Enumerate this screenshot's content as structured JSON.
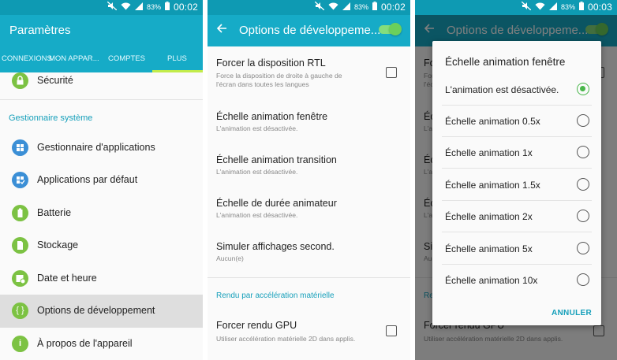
{
  "status_bar": [
    {
      "battery": "83%",
      "time": "00:02"
    },
    {
      "battery": "83%",
      "time": "00:02"
    },
    {
      "battery": "83%",
      "time": "00:03"
    }
  ],
  "settings": {
    "title": "Paramètres",
    "tabs": [
      "CONNEXIONS",
      "MON APPAR...",
      "COMPTES",
      "PLUS"
    ],
    "active_tab": "PLUS",
    "top_item": "Sécurité",
    "section": "Gestionnaire système",
    "items": [
      "Gestionnaire d'applications",
      "Applications par défaut",
      "Batterie",
      "Stockage",
      "Date et heure",
      "Options de développement",
      "À propos de l'appareil"
    ],
    "selected_item": "Options de développement"
  },
  "dev_options": {
    "title": "Options de développeme...",
    "toggle_on": true,
    "rtl": {
      "title": "Forcer la disposition RTL",
      "sub1": "Force la disposition de droite à gauche de",
      "sub2": "l'écran dans toutes les langues"
    },
    "window_scale": {
      "title": "Échelle animation fenêtre",
      "sub": "L'animation est désactivée."
    },
    "transition_scale": {
      "title": "Échelle animation transition",
      "sub": "L'animation est désactivée."
    },
    "duration_scale": {
      "title": "Échelle de durée animateur",
      "sub": "L'animation est désactivée."
    },
    "secondary_display": {
      "title": "Simuler affichages second.",
      "sub": "Aucun(e)"
    },
    "section": "Rendu par accélération matérielle",
    "gpu": {
      "title": "Forcer rendu GPU",
      "sub": "Utiliser accélération matérielle 2D dans applis."
    }
  },
  "dialog": {
    "title": "Échelle animation fenêtre",
    "options": [
      "L'animation est désactivée.",
      "Échelle animation 0.5x",
      "Échelle animation 1x",
      "Échelle animation 1.5x",
      "Échelle animation 2x",
      "Échelle animation 5x",
      "Échelle animation 10x"
    ],
    "selected_index": 0,
    "cancel": "ANNULER"
  },
  "colors": {
    "status_bar": "#0e9ab3",
    "app_bar": "#16abc7",
    "accent_text": "#159fba",
    "tab_indicator": "#c2ec4a",
    "icon_green": "#7cc243",
    "icon_blue": "#3b8fd6",
    "toggle_green": "#6bd05b"
  },
  "icons": {
    "status": [
      "mute-icon",
      "wifi-icon",
      "signal-icon",
      "battery-icon"
    ],
    "settings_items": [
      "apps-grid-icon",
      "default-apps-icon",
      "battery-icon",
      "storage-icon",
      "calendar-clock-icon",
      "developer-braces-icon",
      "info-icon"
    ]
  }
}
